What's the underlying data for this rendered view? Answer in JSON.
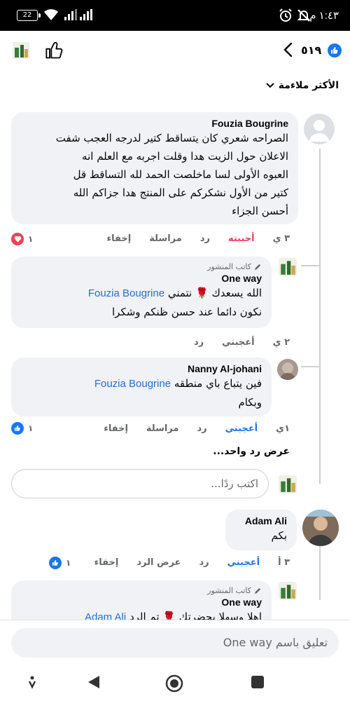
{
  "status": {
    "battery": "22",
    "time": "١:٤٣ م"
  },
  "header": {
    "likes_count": "٥١٩",
    "back_icon": "chevron-left-icon",
    "like_icon": "thumbs-up-outline-icon"
  },
  "sort": {
    "label": "الأكثر ملاءمة"
  },
  "comments": [
    {
      "name": "Fouzia Bougrine",
      "lines": [
        "الصراحه شعري كان يتساقط كتير لدرجه العجب شفت",
        "الاعلان حول الزيت هدا وقلت اجربه مع العلم انه",
        "العبوه الأولى لسا ماخلصت الحمد لله التساقط قل",
        "كتير من الأول نشكركم على المنتج هدا جزاكم الله",
        "أحسن الجزاء"
      ],
      "time": "٣ ي",
      "actions": [
        "أحببته",
        "رد",
        "مراسلة",
        "إخفاء"
      ],
      "reaction_count": "١",
      "reaction": "love"
    },
    {
      "author_tag": "كاتب المنشور",
      "name": "One way",
      "lines": [
        "الله يسعدك 🌹 نتمني",
        "نكون دائما عند حسن ظنكم وشكرا"
      ],
      "mention": "Fouzia Bougrine",
      "time": "٢ ي",
      "actions": [
        "أعجبني",
        "رد"
      ]
    },
    {
      "name": "Nanny Al-johani",
      "lines": [
        "فين يتباع باي منطقه",
        "وبكام"
      ],
      "mention": "Fouzia Bougrine",
      "time": "١ي",
      "actions": [
        "أعجبني",
        "رد",
        "مراسلة",
        "إخفاء"
      ],
      "reaction_count": "١",
      "reaction": "like"
    },
    {
      "name": "Adam Ali",
      "lines": [
        "بكم"
      ],
      "time": "٣ أ",
      "actions": [
        "أعجبني",
        "رد",
        "عرض الرد",
        "إخفاء"
      ],
      "reaction_count": "١",
      "reaction": "like"
    },
    {
      "author_tag": "كاتب المنشور",
      "name": "One way",
      "lines": [
        "اهلا وسهلا بحضرتك 🌹 تم الرد"
      ],
      "mention": "Adam Ali"
    }
  ],
  "view_more_replies": "عرض رد واحد...",
  "reply_placeholder": "اكتب ردًا...",
  "composer_placeholder": "تعليق باسم One way",
  "colors": {
    "accent": "#1877f2",
    "love": "#f33e58",
    "bubble": "#f0f2f5"
  }
}
